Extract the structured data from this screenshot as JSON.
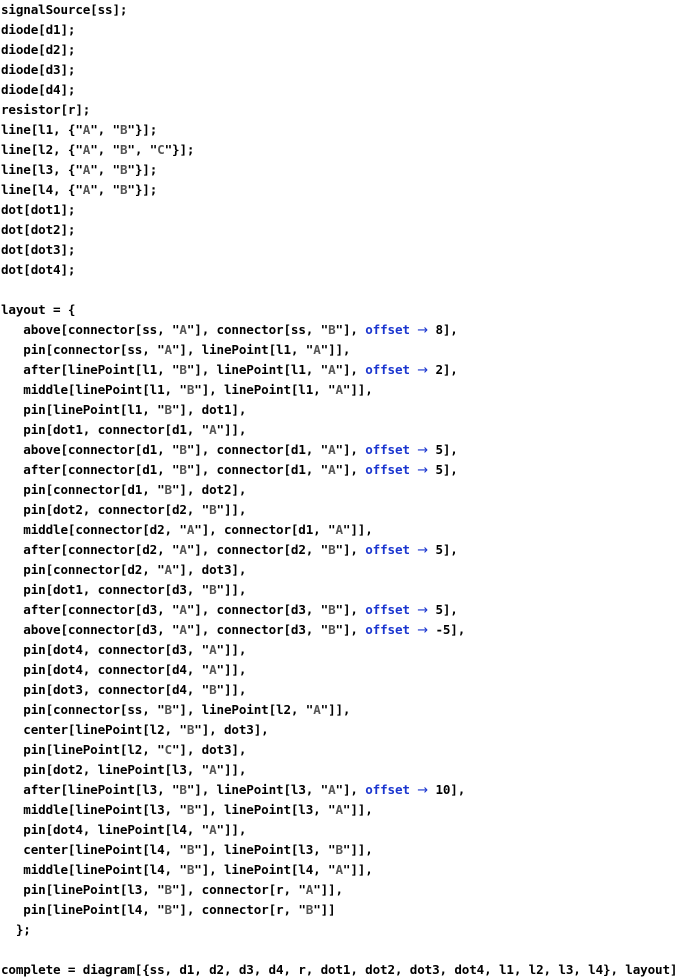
{
  "document": {
    "kind": "code-listing",
    "language": "Wolfram Language",
    "colors": {
      "background": "#ffffff",
      "identifier": "#000000",
      "string": "#555555",
      "option_keyword": "#1a35d0",
      "arrow": "#1a35d0"
    },
    "arrow_glyph": "→",
    "lines": [
      {
        "indent": 0,
        "text": "signalSource[ss];"
      },
      {
        "indent": 0,
        "text": "diode[d1];"
      },
      {
        "indent": 0,
        "text": "diode[d2];"
      },
      {
        "indent": 0,
        "text": "diode[d3];"
      },
      {
        "indent": 0,
        "text": "diode[d4];"
      },
      {
        "indent": 0,
        "text": "resistor[r];"
      },
      {
        "indent": 0,
        "text": "line[l1, {\"A\", \"B\"}];"
      },
      {
        "indent": 0,
        "text": "line[l2, {\"A\", \"B\", \"C\"}];"
      },
      {
        "indent": 0,
        "text": "line[l3, {\"A\", \"B\"}];"
      },
      {
        "indent": 0,
        "text": "line[l4, {\"A\", \"B\"}];"
      },
      {
        "indent": 0,
        "text": "dot[dot1];"
      },
      {
        "indent": 0,
        "text": "dot[dot2];"
      },
      {
        "indent": 0,
        "text": "dot[dot3];"
      },
      {
        "indent": 0,
        "text": "dot[dot4];"
      },
      {
        "indent": 0,
        "text": ""
      },
      {
        "indent": 0,
        "text": "layout = {"
      },
      {
        "indent": 3,
        "text": "above[connector[ss, \"A\"], connector[ss, \"B\"], offset → 8],"
      },
      {
        "indent": 3,
        "text": "pin[connector[ss, \"A\"], linePoint[l1, \"A\"]],"
      },
      {
        "indent": 3,
        "text": "after[linePoint[l1, \"B\"], linePoint[l1, \"A\"], offset → 2],"
      },
      {
        "indent": 3,
        "text": "middle[linePoint[l1, \"B\"], linePoint[l1, \"A\"]],"
      },
      {
        "indent": 3,
        "text": "pin[linePoint[l1, \"B\"], dot1],"
      },
      {
        "indent": 3,
        "text": "pin[dot1, connector[d1, \"A\"]],"
      },
      {
        "indent": 3,
        "text": "above[connector[d1, \"B\"], connector[d1, \"A\"], offset → 5],"
      },
      {
        "indent": 3,
        "text": "after[connector[d1, \"B\"], connector[d1, \"A\"], offset → 5],"
      },
      {
        "indent": 3,
        "text": "pin[connector[d1, \"B\"], dot2],"
      },
      {
        "indent": 3,
        "text": "pin[dot2, connector[d2, \"B\"]],"
      },
      {
        "indent": 3,
        "text": "middle[connector[d2, \"A\"], connector[d1, \"A\"]],"
      },
      {
        "indent": 3,
        "text": "after[connector[d2, \"A\"], connector[d2, \"B\"], offset → 5],"
      },
      {
        "indent": 3,
        "text": "pin[connector[d2, \"A\"], dot3],"
      },
      {
        "indent": 3,
        "text": "pin[dot1, connector[d3, \"B\"]],"
      },
      {
        "indent": 3,
        "text": "after[connector[d3, \"A\"], connector[d3, \"B\"], offset → 5],"
      },
      {
        "indent": 3,
        "text": "above[connector[d3, \"A\"], connector[d3, \"B\"], offset → -5],"
      },
      {
        "indent": 3,
        "text": "pin[dot4, connector[d3, \"A\"]],"
      },
      {
        "indent": 3,
        "text": "pin[dot4, connector[d4, \"A\"]],"
      },
      {
        "indent": 3,
        "text": "pin[dot3, connector[d4, \"B\"]],"
      },
      {
        "indent": 3,
        "text": "pin[connector[ss, \"B\"], linePoint[l2, \"A\"]],"
      },
      {
        "indent": 3,
        "text": "center[linePoint[l2, \"B\"], dot3],"
      },
      {
        "indent": 3,
        "text": "pin[linePoint[l2, \"C\"], dot3],"
      },
      {
        "indent": 3,
        "text": "pin[dot2, linePoint[l3, \"A\"]],"
      },
      {
        "indent": 3,
        "text": "after[linePoint[l3, \"B\"], linePoint[l3, \"A\"], offset → 10],"
      },
      {
        "indent": 3,
        "text": "middle[linePoint[l3, \"B\"], linePoint[l3, \"A\"]],"
      },
      {
        "indent": 3,
        "text": "pin[dot4, linePoint[l4, \"A\"]],"
      },
      {
        "indent": 3,
        "text": "center[linePoint[l4, \"B\"], linePoint[l3, \"B\"]],"
      },
      {
        "indent": 3,
        "text": "middle[linePoint[l4, \"B\"], linePoint[l4, \"A\"]],"
      },
      {
        "indent": 3,
        "text": "pin[linePoint[l3, \"B\"], connector[r, \"A\"]],"
      },
      {
        "indent": 3,
        "text": "pin[linePoint[l4, \"B\"], connector[r, \"B\"]]"
      },
      {
        "indent": 2,
        "text": "};"
      },
      {
        "indent": 0,
        "text": ""
      },
      {
        "indent": 0,
        "text": "complete = diagram[{ss, d1, d2, d3, d4, r, dot1, dot2, dot3, dot4, l1, l2, l3, l4}, layout]"
      }
    ]
  }
}
